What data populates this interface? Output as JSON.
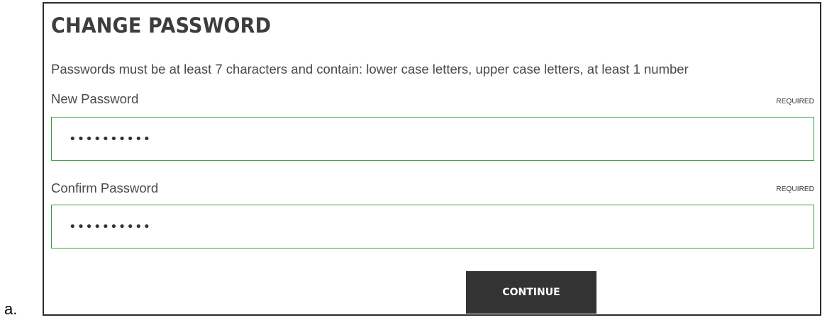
{
  "list_marker": "a.",
  "form": {
    "title": "CHANGE PASSWORD",
    "hint": "Passwords must be at least 7 characters and contain: lower case letters, upper case letters, at least 1 number",
    "fields": [
      {
        "label": "New Password",
        "required_label": "REQUIRED",
        "value": "••••••••••"
      },
      {
        "label": "Confirm Password",
        "required_label": "REQUIRED",
        "value": "••••••••••"
      }
    ],
    "continue_label": "CONTINUE"
  },
  "colors": {
    "border": "#2b2b2b",
    "input_border_valid": "#3a9a3a",
    "button_bg": "#333333",
    "text": "#4a4a4a"
  }
}
